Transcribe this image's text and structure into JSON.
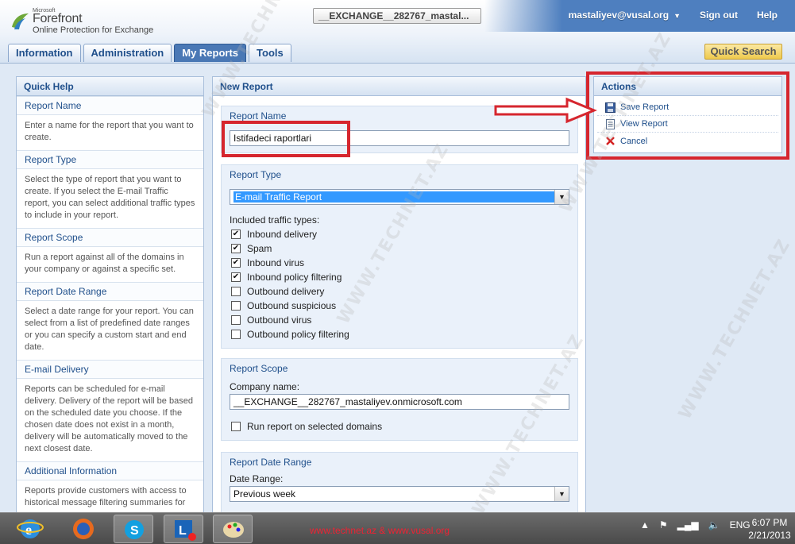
{
  "header": {
    "logo_brand": "Microsoft",
    "logo_product": "Forefront",
    "logo_subtitle": "Online Protection for Exchange",
    "tenant": "__EXCHANGE__282767_mastal...",
    "user": "mastaliyev@vusal.org",
    "sign_out": "Sign out",
    "help": "Help"
  },
  "tabs": [
    {
      "label": "Information"
    },
    {
      "label": "Administration"
    },
    {
      "label": "My Reports"
    },
    {
      "label": "Tools"
    }
  ],
  "quick_search": "Quick Search",
  "quick_help": {
    "title": "Quick Help",
    "items": [
      {
        "heading": "Report Name",
        "text": "Enter a name for the report that you want to create."
      },
      {
        "heading": "Report Type",
        "text": "Select the type of report that you want to create. If you select the E-mail Traffic report, you can select additional traffic types to include in your report."
      },
      {
        "heading": "Report Scope",
        "text": "Run a report against all of the domains in your company or against a specific set."
      },
      {
        "heading": "Report Date Range",
        "text": "Select a date range for your report. You can select from a list of predefined date ranges or you can specify a custom start and end date."
      },
      {
        "heading": "E-mail Delivery",
        "text": "Reports can be scheduled for e-mail delivery. Delivery of the report will be based on the scheduled date you choose. If the chosen date does not exist in a month, delivery will be automatically moved to the next closest date."
      },
      {
        "heading": "Additional Information",
        "text": "Reports provide customers with access to historical message filtering summaries for"
      }
    ]
  },
  "new_report": {
    "title": "New Report",
    "name_section": {
      "heading": "Report Name",
      "value": "Istifadeci raportlari"
    },
    "type_section": {
      "heading": "Report Type",
      "selected": "E-mail Traffic Report",
      "included_label": "Included traffic types:",
      "traffic_types": [
        {
          "label": "Inbound delivery",
          "checked": true
        },
        {
          "label": "Spam",
          "checked": true
        },
        {
          "label": "Inbound virus",
          "checked": true
        },
        {
          "label": "Inbound policy filtering",
          "checked": true
        },
        {
          "label": "Outbound delivery",
          "checked": false
        },
        {
          "label": "Outbound suspicious",
          "checked": false
        },
        {
          "label": "Outbound virus",
          "checked": false
        },
        {
          "label": "Outbound policy filtering",
          "checked": false
        }
      ]
    },
    "scope_section": {
      "heading": "Report Scope",
      "company_label": "Company name:",
      "company_value": "__EXCHANGE__282767_mastaliyev.onmicrosoft.com",
      "selected_domains_label": "Run report on selected domains"
    },
    "range_section": {
      "heading": "Report Date Range",
      "date_label": "Date Range:",
      "selected": "Previous week"
    }
  },
  "actions": {
    "title": "Actions",
    "items": [
      {
        "label": "Save Report",
        "icon": "save-icon"
      },
      {
        "label": "View Report",
        "icon": "view-report-icon"
      },
      {
        "label": "Cancel",
        "icon": "cancel-icon"
      }
    ]
  },
  "taskbar": {
    "footer_text": "www.technet.az & www.vusal.org",
    "language": "ENG",
    "time": "6:07 PM",
    "date": "2/21/2013"
  },
  "watermark": "WWW.TECHNET.AZ",
  "colors": {
    "accent": "#1f4f8b",
    "callout_red": "#d6262e",
    "selection_blue": "#3399ff",
    "quick_search_gold": "#eec94d"
  }
}
